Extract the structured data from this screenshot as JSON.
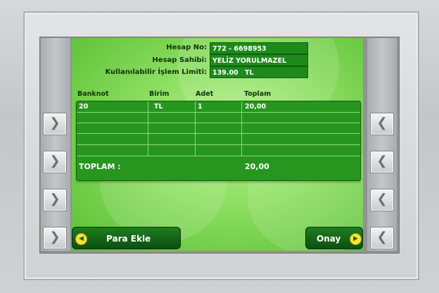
{
  "account": {
    "hesap_no_label": "Hesap No:",
    "hesap_no_value": "772 - 6698953",
    "hesap_sahibi_label": "Hesap Sahibi:",
    "hesap_sahibi_value": "YELİZ YORULMAZEL",
    "limit_label": "Kullanılabilir İşlem Limiti:",
    "limit_value": "139.00",
    "limit_currency": "TL"
  },
  "table": {
    "headers": [
      "Banknot",
      "Birim",
      "Adet",
      "Toplam"
    ],
    "rows": [
      [
        "20",
        "TL",
        "1",
        "20,00"
      ]
    ],
    "total_label": "TOPLAM :",
    "total_value": "20,00"
  },
  "buttons": {
    "left_label": "Para Ekle",
    "right_label": "Onay"
  },
  "icons": {
    "side_key": "chevron-icon",
    "left_button": "arrow-left-circle-icon",
    "right_button": "arrow-right-circle-icon"
  },
  "colors": {
    "screen_green": "#8fe063",
    "box_green": "#26961f",
    "button_dark_green": "#0b4f10",
    "accent_yellow": "#ffe23a"
  }
}
